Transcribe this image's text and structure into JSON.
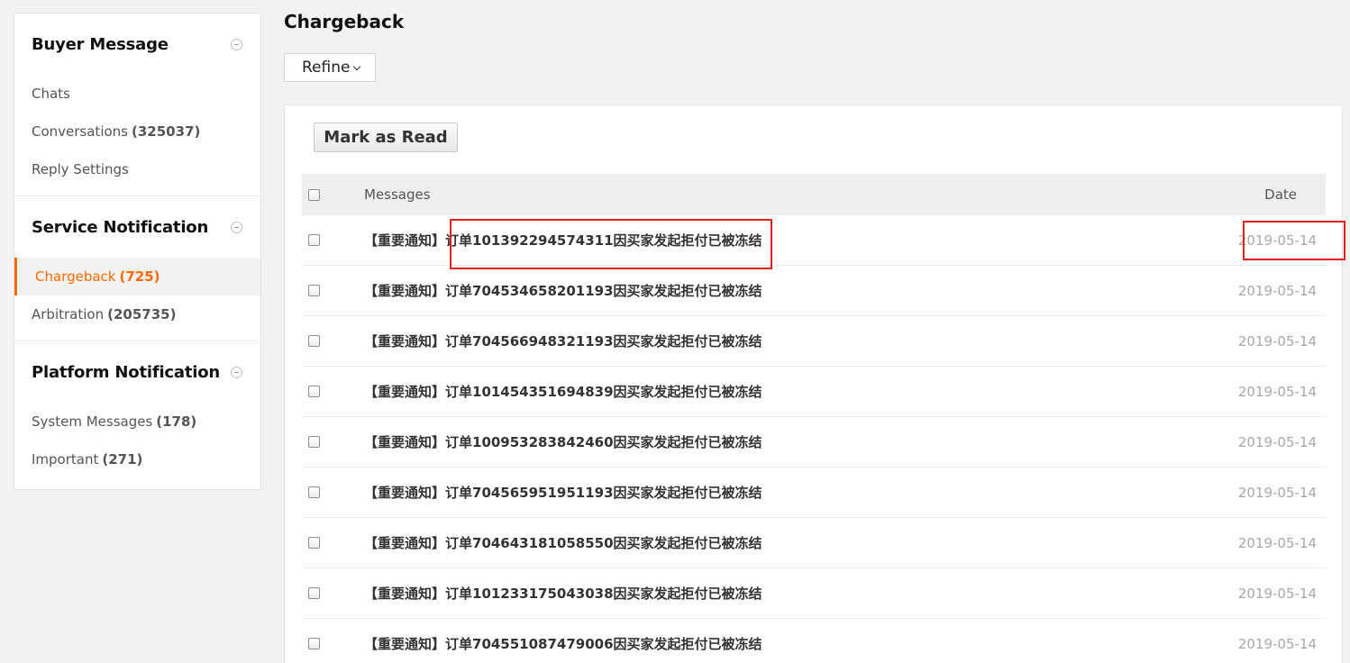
{
  "sidebar": {
    "sections": [
      {
        "title": "Buyer Message",
        "items": [
          {
            "label": "Chats",
            "count": ""
          },
          {
            "label": "Conversations",
            "count": "(325037)"
          },
          {
            "label": "Reply Settings",
            "count": ""
          }
        ]
      },
      {
        "title": "Service Notification",
        "items": [
          {
            "label": "Chargeback",
            "count": "(725)"
          },
          {
            "label": "Arbitration",
            "count": "(205735)"
          }
        ]
      },
      {
        "title": "Platform Notification",
        "items": [
          {
            "label": "System Messages",
            "count": "(178)"
          },
          {
            "label": "Important",
            "count": "(271)"
          }
        ]
      }
    ]
  },
  "page": {
    "title": "Chargeback",
    "refine_label": "Refine",
    "mark_read_label": "Mark as Read"
  },
  "table": {
    "headers": {
      "messages": "Messages",
      "date": "Date"
    },
    "rows": [
      {
        "message": "【重要通知】订单101392294574311因买家发起拒付已被冻结",
        "date": "2019-05-14"
      },
      {
        "message": "【重要通知】订单704534658201193因买家发起拒付已被冻结",
        "date": "2019-05-14"
      },
      {
        "message": "【重要通知】订单704566948321193因买家发起拒付已被冻结",
        "date": "2019-05-14"
      },
      {
        "message": "【重要通知】订单101454351694839因买家发起拒付已被冻结",
        "date": "2019-05-14"
      },
      {
        "message": "【重要通知】订单100953283842460因买家发起拒付已被冻结",
        "date": "2019-05-14"
      },
      {
        "message": "【重要通知】订单704565951951193因买家发起拒付已被冻结",
        "date": "2019-05-14"
      },
      {
        "message": "【重要通知】订单704643181058550因买家发起拒付已被冻结",
        "date": "2019-05-14"
      },
      {
        "message": "【重要通知】订单101233175043038因买家发起拒付已被冻结",
        "date": "2019-05-14"
      },
      {
        "message": "【重要通知】订单704551087479006因买家发起拒付已被冻结",
        "date": "2019-05-14"
      }
    ]
  },
  "colors": {
    "accent": "#ff6a00",
    "highlight": "#e0201e"
  }
}
